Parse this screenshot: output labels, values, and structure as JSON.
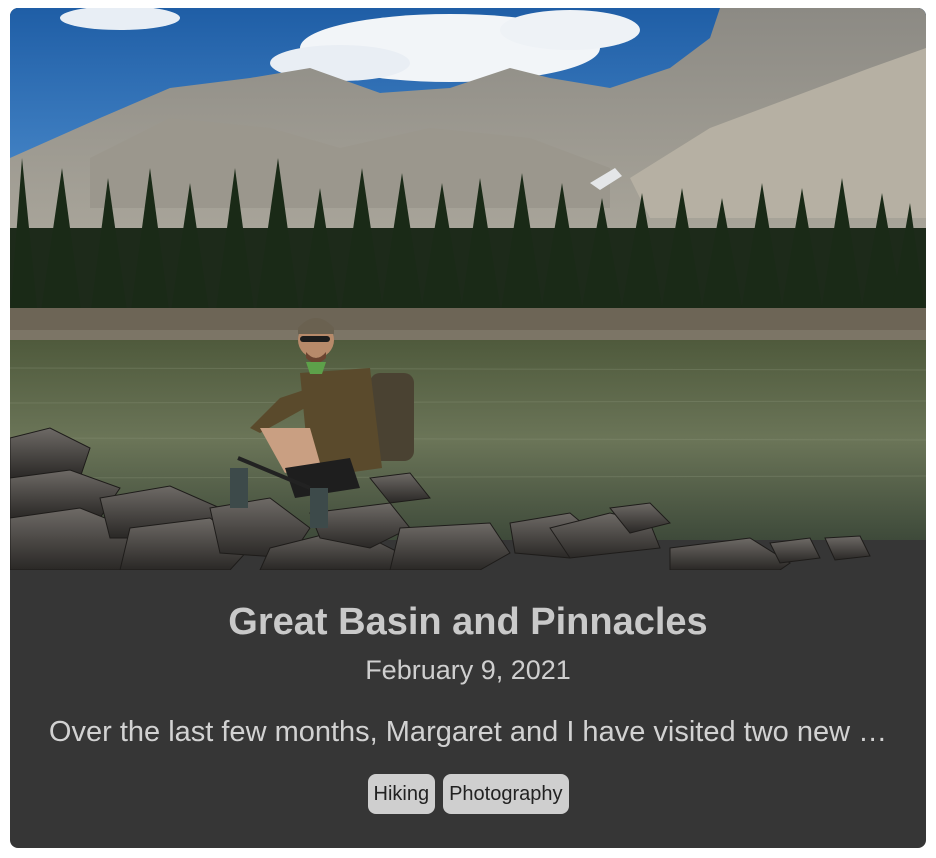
{
  "post": {
    "image_alt": "Hiker sitting on rocks beside an alpine lake below mountain peaks",
    "title": "Great Basin and Pinnacles",
    "date": "February 9, 2021",
    "excerpt": "Over the last few months, Margaret and I have visited two new …",
    "tags": [
      "Hiking",
      "Photography"
    ]
  },
  "colors": {
    "card_background": "#363636",
    "tag_background": "#cfcfcf",
    "text": "#d2d2d2"
  }
}
